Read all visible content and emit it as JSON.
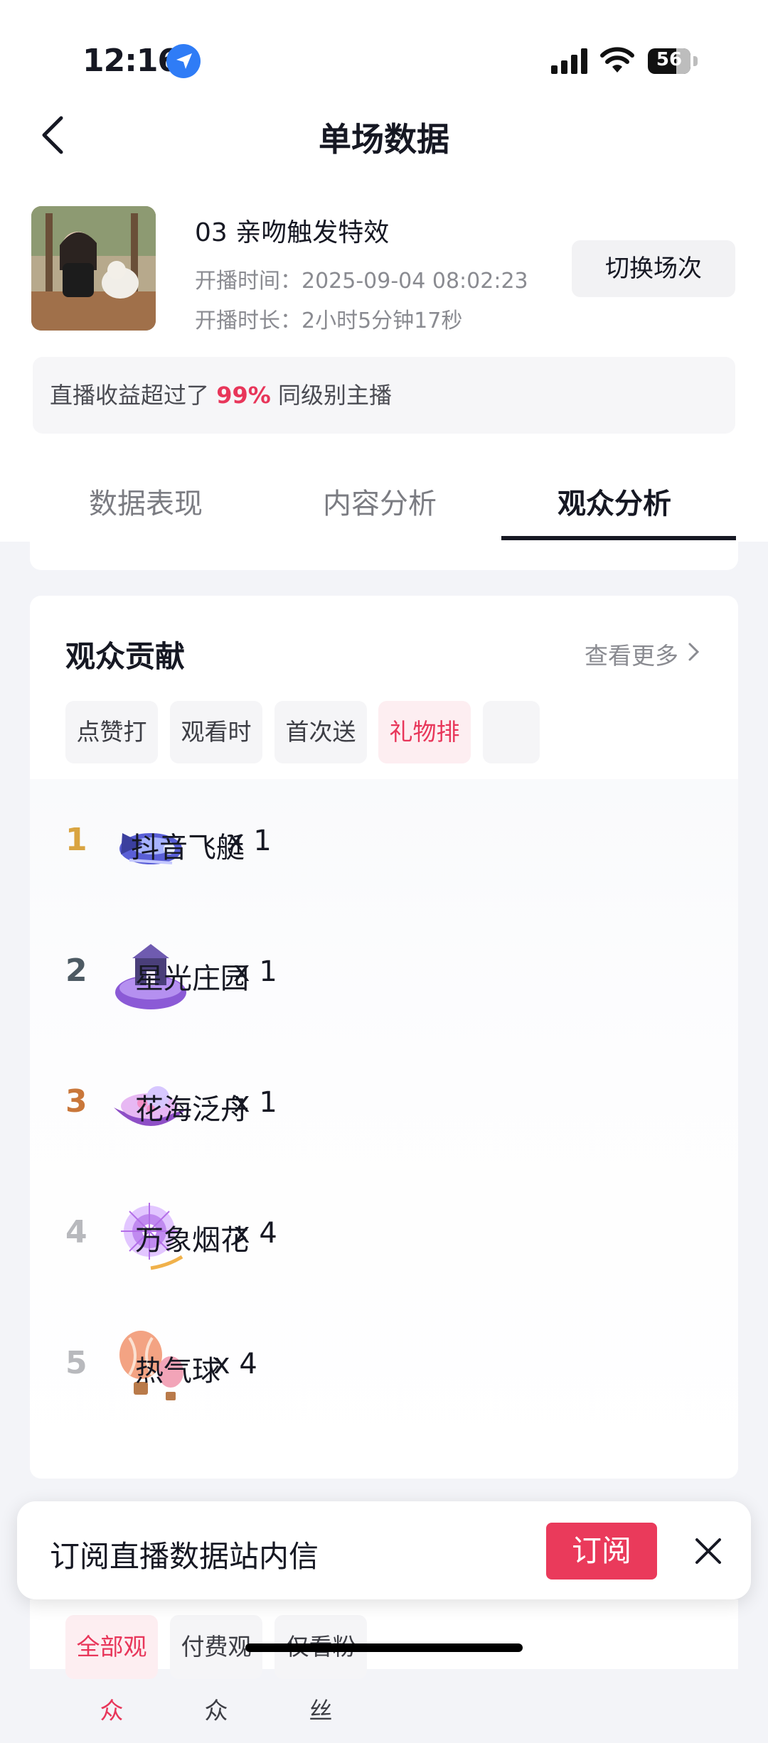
{
  "status_bar": {
    "time": "12:16",
    "battery": "56"
  },
  "nav": {
    "title": "单场数据"
  },
  "session": {
    "name": "03 亲吻触发特效",
    "start_label": "开播时间：",
    "start_time": "2025-09-04 08:02:23",
    "duration_label": "开播时长：",
    "duration": "2小时5分钟17秒",
    "switch_label": "切换场次"
  },
  "rank_banner": {
    "prefix": "直播收益超过了",
    "percent": "99%",
    "suffix": "同级别主播"
  },
  "tabs": [
    {
      "label": "数据表现",
      "active": false
    },
    {
      "label": "内容分析",
      "active": false
    },
    {
      "label": "观众分析",
      "active": true
    }
  ],
  "contribution": {
    "title": "观众贡献",
    "more_label": "查看更多",
    "chips": [
      {
        "label": "点赞打赏",
        "active": false
      },
      {
        "label": "观看时长",
        "active": false
      },
      {
        "label": "首次送礼",
        "active": false
      },
      {
        "label": "礼物排行",
        "active": true
      }
    ],
    "gifts": [
      {
        "rank": "1",
        "name": "抖音飞艇",
        "count": "x 1",
        "rank_color": "#d9a441"
      },
      {
        "rank": "2",
        "name": "星光庄园",
        "count": "x 1",
        "rank_color": "#4d5a63"
      },
      {
        "rank": "3",
        "name": "花海泛舟",
        "count": "x 1",
        "rank_color": "#c9773a"
      },
      {
        "rank": "4",
        "name": "万象烟花",
        "count": "x 4",
        "rank_color": "#b8b9bd"
      },
      {
        "rank": "5",
        "name": "热气球",
        "count": "x 4",
        "rank_color": "#b8b9bd"
      }
    ]
  },
  "toast": {
    "text": "订阅直播数据站内信",
    "button": "订阅"
  },
  "audience_filter": {
    "chips": [
      {
        "label": "全部观众",
        "active": true
      },
      {
        "label": "付费观众",
        "active": false
      },
      {
        "label": "仅看粉丝",
        "active": false
      }
    ]
  }
}
